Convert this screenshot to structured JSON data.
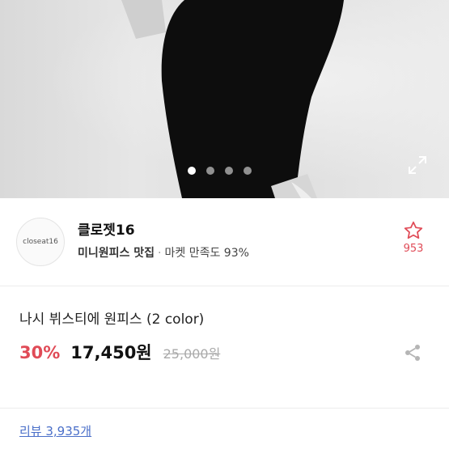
{
  "gallery": {
    "slide_count": 4,
    "active_slide": 1,
    "expand_icon": "expand-arrows-icon"
  },
  "shop": {
    "logo_text": "closeat16",
    "name": "클로젯16",
    "tagline": "미니원피스 맛집",
    "separator": "·",
    "satisfaction": "마켓 만족도 93%",
    "favorite_icon": "star-outline-icon",
    "favorite_count": "953",
    "accent_color": "#e04b57"
  },
  "product": {
    "title": "나시 뷔스티에 원피스 (2 color)",
    "discount": "30%",
    "price": "17,450원",
    "original_price": "25,000원",
    "share_icon": "share-icon"
  },
  "reviews": {
    "label": "리뷰 3,935개",
    "link_color": "#4a6fc9"
  }
}
